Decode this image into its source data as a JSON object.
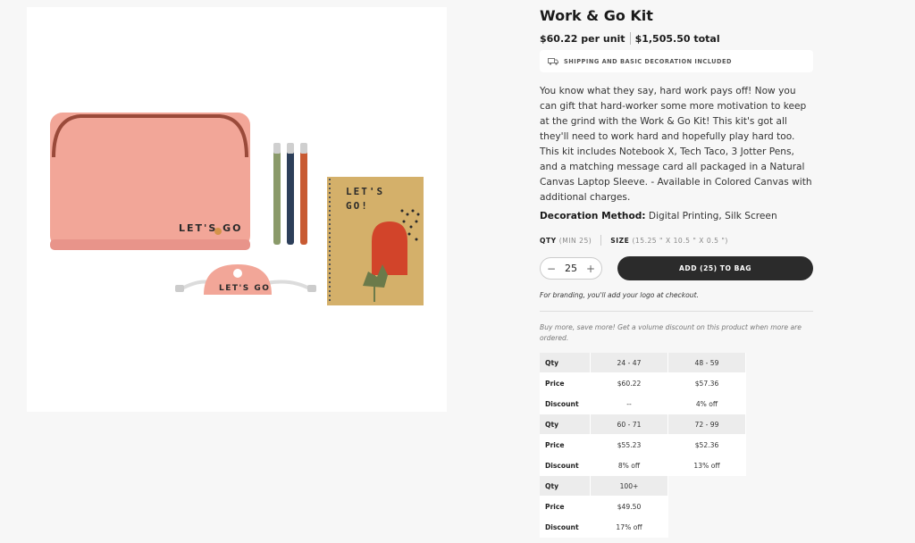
{
  "product": {
    "title": "Work & Go Kit",
    "price_unit": "$60.22 per unit",
    "price_total": "$1,505.50 total",
    "shipping_note": "SHIPPING AND BASIC DECORATION INCLUDED",
    "description": "You know what they say, hard work pays off! Now you can gift that hard-worker some more motivation to keep at the grind with the Work & Go Kit! This kit's got all they'll need to work hard and hopefully play hard too. This kit includes Notebook X, Tech Taco, 3 Jotter Pens, and a matching message card all packaged in a Natural Canvas Laptop Sleeve. - Available in Colored Canvas with additional charges.",
    "decoration_label": "Decoration Method:",
    "decoration_value": "Digital Printing, Silk Screen",
    "image_text": {
      "sleeve": "LET'S GO",
      "notebook_line1": "LET'S",
      "notebook_line2": "GO!",
      "taco": "LET'S GO"
    }
  },
  "order": {
    "qty_label": "QTY",
    "qty_min": "(MIN 25)",
    "size_label": "SIZE",
    "size_value": "(15.25 \" X 10.5 \" X 0.5 \")",
    "qty_value": "25",
    "minus": "−",
    "plus": "+",
    "add_button": "ADD (25) TO BAG",
    "branding_note": "For branding, you'll add your logo at checkout.",
    "volume_note": "Buy more, save more! Get a volume discount on this product when more are ordered."
  },
  "tiers": {
    "labels": {
      "qty": "Qty",
      "price": "Price",
      "discount": "Discount"
    },
    "groups": [
      {
        "qty": [
          "24 - 47",
          "48 - 59"
        ],
        "price": [
          "$60.22",
          "$57.36"
        ],
        "discount": [
          "--",
          "4% off"
        ]
      },
      {
        "qty": [
          "60 - 71",
          "72 - 99"
        ],
        "price": [
          "$55.23",
          "$52.36"
        ],
        "discount": [
          "8% off",
          "13% off"
        ]
      },
      {
        "qty": [
          "100+"
        ],
        "price": [
          "$49.50"
        ],
        "discount": [
          "17% off"
        ]
      }
    ]
  },
  "colors": {
    "sleeve": "#f2a698",
    "button": "#2b2b2b",
    "notebook": "#d4b06a",
    "accent_red": "#d2442a",
    "leaf": "#6b7a4a"
  }
}
